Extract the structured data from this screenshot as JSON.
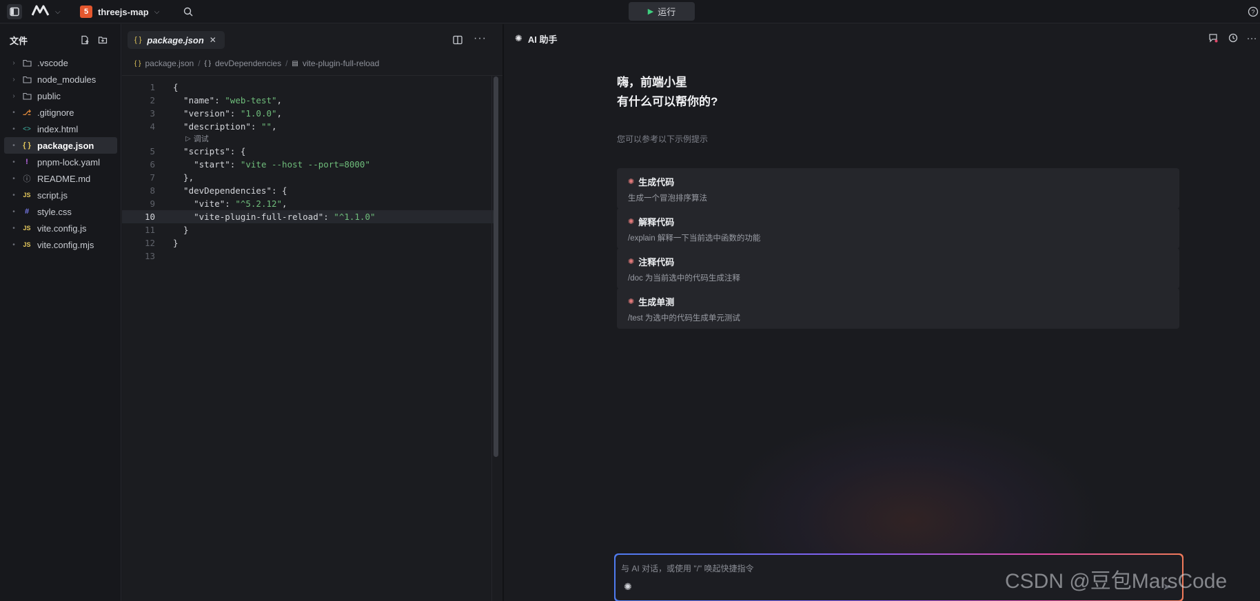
{
  "topbar": {
    "project_name": "threejs-map",
    "run_label": "运行",
    "html5_badge": "5"
  },
  "explorer": {
    "title": "文件",
    "items": [
      {
        "label": ".vscode",
        "type": "folder"
      },
      {
        "label": "node_modules",
        "type": "folder"
      },
      {
        "label": "public",
        "type": "folder"
      },
      {
        "label": ".gitignore",
        "type": "git"
      },
      {
        "label": "index.html",
        "type": "html"
      },
      {
        "label": "package.json",
        "type": "json",
        "active": true
      },
      {
        "label": "pnpm-lock.yaml",
        "type": "yaml"
      },
      {
        "label": "README.md",
        "type": "md"
      },
      {
        "label": "script.js",
        "type": "js"
      },
      {
        "label": "style.css",
        "type": "css"
      },
      {
        "label": "vite.config.js",
        "type": "js"
      },
      {
        "label": "vite.config.mjs",
        "type": "js"
      }
    ]
  },
  "editor": {
    "tab_label": "package.json",
    "breadcrumb": [
      "package.json",
      "devDependencies",
      "vite-plugin-full-reload"
    ],
    "codelens_label": "调试",
    "current_line": 10,
    "lines": [
      {
        "n": "1",
        "tokens": [
          [
            "k",
            "{"
          ]
        ]
      },
      {
        "n": "2",
        "tokens": [
          [
            "k",
            "  \"name\": "
          ],
          [
            "s",
            "\"web-test\""
          ],
          [
            "k",
            ","
          ]
        ]
      },
      {
        "n": "3",
        "tokens": [
          [
            "k",
            "  \"version\": "
          ],
          [
            "s",
            "\"1.0.0\""
          ],
          [
            "k",
            ","
          ]
        ]
      },
      {
        "n": "4",
        "tokens": [
          [
            "k",
            "  \"description\": "
          ],
          [
            "s",
            "\"\""
          ],
          [
            "k",
            ","
          ]
        ]
      },
      {
        "n": "5",
        "tokens": [
          [
            "k",
            "  \"scripts\": {"
          ]
        ]
      },
      {
        "n": "6",
        "tokens": [
          [
            "k",
            "    \"start\": "
          ],
          [
            "s",
            "\"vite --host --port=8000\""
          ]
        ]
      },
      {
        "n": "7",
        "tokens": [
          [
            "k",
            "  },"
          ]
        ]
      },
      {
        "n": "8",
        "tokens": [
          [
            "k",
            "  \"devDependencies\": {"
          ]
        ]
      },
      {
        "n": "9",
        "tokens": [
          [
            "k",
            "    \"vite\": "
          ],
          [
            "s",
            "\"^5.2.12\""
          ],
          [
            "k",
            ","
          ]
        ]
      },
      {
        "n": "10",
        "tokens": [
          [
            "k",
            "    \"vite-plugin-full-reload\": "
          ],
          [
            "s",
            "\"^1.1.0\""
          ]
        ]
      },
      {
        "n": "11",
        "tokens": [
          [
            "k",
            "  }"
          ]
        ]
      },
      {
        "n": "12",
        "tokens": [
          [
            "k",
            "}"
          ]
        ]
      },
      {
        "n": "13",
        "tokens": []
      }
    ]
  },
  "ai": {
    "title": "AI 助手",
    "greeting_line1": "嗨，前端小星",
    "greeting_line2": "有什么可以帮你的?",
    "hint": "您可以参考以下示例提示",
    "suggestions": [
      {
        "title": "生成代码",
        "desc": "生成一个冒泡排序算法"
      },
      {
        "title": "解释代码",
        "desc": "/explain 解释一下当前选中函数的功能"
      },
      {
        "title": "注释代码",
        "desc": "/doc 为当前选中的代码生成注释"
      },
      {
        "title": "生成单测",
        "desc": "/test 为选中的代码生成单元测试"
      }
    ],
    "input_placeholder": "与 AI 对话，或使用 \"/\" 唤起快捷指令"
  },
  "watermark": "CSDN @豆包MarsCode",
  "colors": {
    "accent_green": "#3fcf7f",
    "string_green": "#6fbd7b",
    "json_yellow": "#e3c75c",
    "gradient_start": "#4f7cf0",
    "gradient_end": "#f07a5a"
  }
}
